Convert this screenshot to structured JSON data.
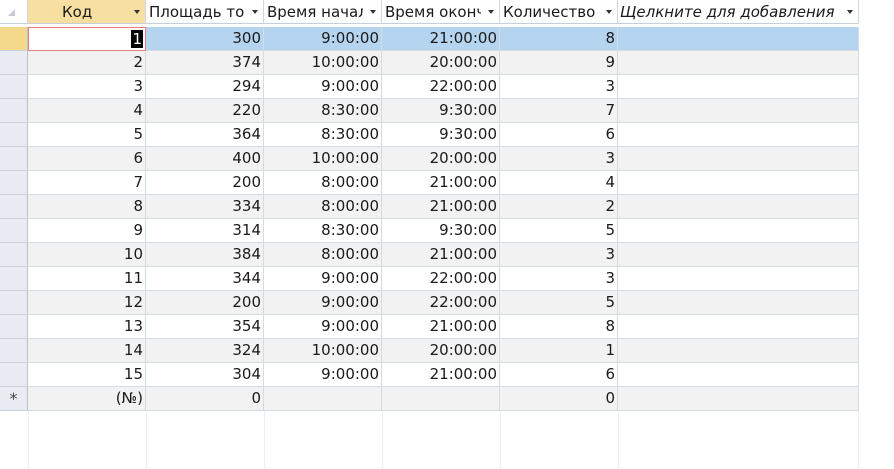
{
  "headers": {
    "kod": "Код",
    "area": "Площадь то",
    "start": "Время начал",
    "end": "Время оконч",
    "count": "Количество",
    "add": "Щелкните для добавления"
  },
  "rows": [
    {
      "kod": "1",
      "area": "300",
      "start": "9:00:00",
      "end": "21:00:00",
      "count": "8"
    },
    {
      "kod": "2",
      "area": "374",
      "start": "10:00:00",
      "end": "20:00:00",
      "count": "9"
    },
    {
      "kod": "3",
      "area": "294",
      "start": "9:00:00",
      "end": "22:00:00",
      "count": "3"
    },
    {
      "kod": "4",
      "area": "220",
      "start": "8:30:00",
      "end": "9:30:00",
      "count": "7"
    },
    {
      "kod": "5",
      "area": "364",
      "start": "8:30:00",
      "end": "9:30:00",
      "count": "6"
    },
    {
      "kod": "6",
      "area": "400",
      "start": "10:00:00",
      "end": "20:00:00",
      "count": "3"
    },
    {
      "kod": "7",
      "area": "200",
      "start": "8:00:00",
      "end": "21:00:00",
      "count": "4"
    },
    {
      "kod": "8",
      "area": "334",
      "start": "8:00:00",
      "end": "21:00:00",
      "count": "2"
    },
    {
      "kod": "9",
      "area": "314",
      "start": "8:30:00",
      "end": "9:30:00",
      "count": "5"
    },
    {
      "kod": "10",
      "area": "384",
      "start": "8:00:00",
      "end": "21:00:00",
      "count": "3"
    },
    {
      "kod": "11",
      "area": "344",
      "start": "9:00:00",
      "end": "22:00:00",
      "count": "3"
    },
    {
      "kod": "12",
      "area": "200",
      "start": "9:00:00",
      "end": "22:00:00",
      "count": "5"
    },
    {
      "kod": "13",
      "area": "354",
      "start": "9:00:00",
      "end": "21:00:00",
      "count": "8"
    },
    {
      "kod": "14",
      "area": "324",
      "start": "10:00:00",
      "end": "20:00:00",
      "count": "1"
    },
    {
      "kod": "15",
      "area": "304",
      "start": "9:00:00",
      "end": "21:00:00",
      "count": "6"
    }
  ],
  "new_row": {
    "marker": "*",
    "kod": "(№)",
    "area": "0",
    "count": "0"
  },
  "colors": {
    "selected_row": "#b5d4ef",
    "active_header": "#f6dfa0",
    "row_alt": "#f2f2f2"
  }
}
